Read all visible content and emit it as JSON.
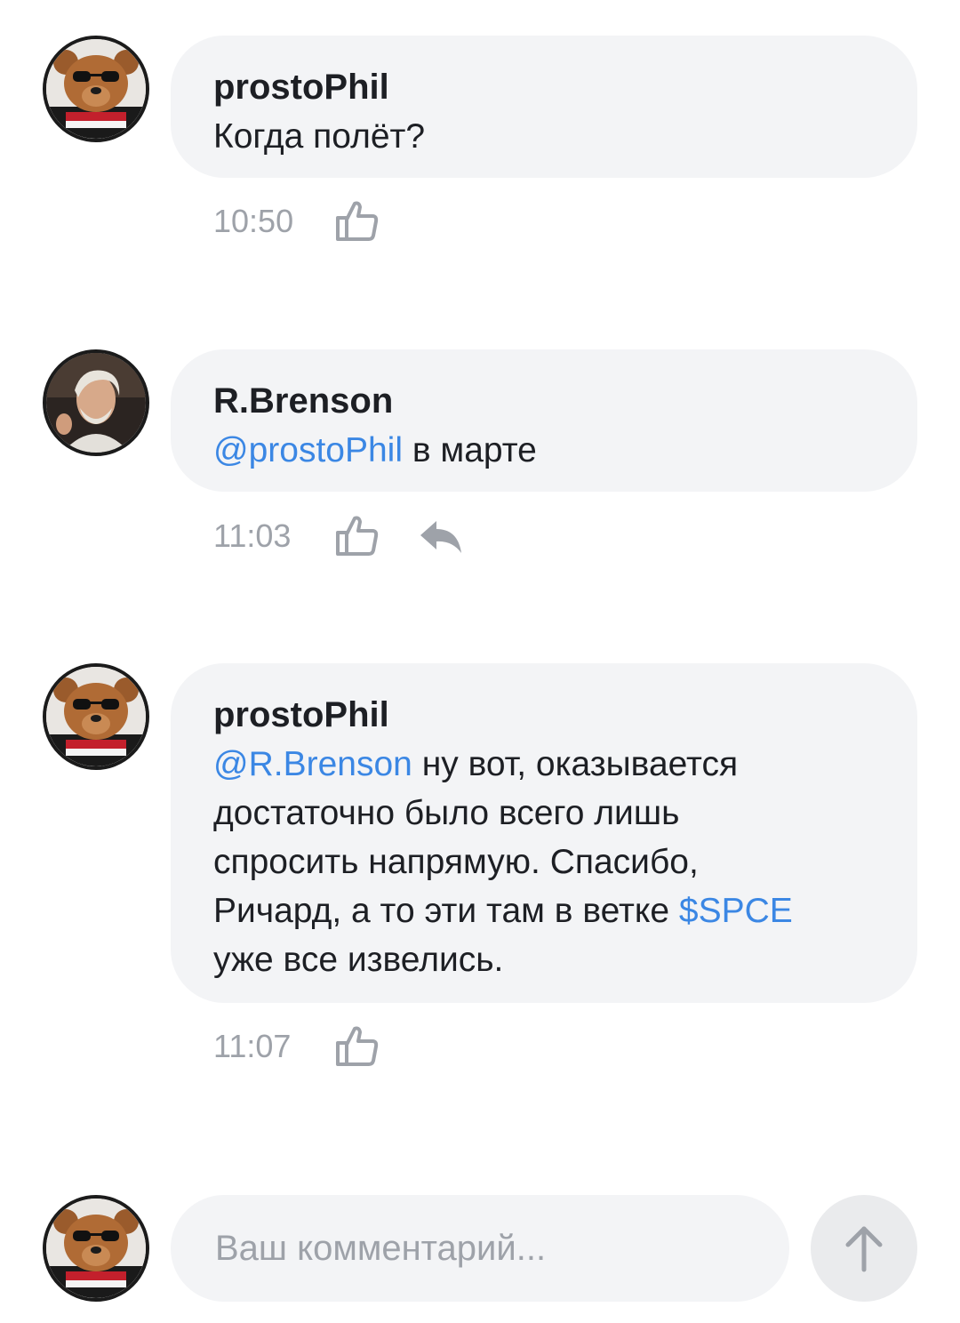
{
  "comments": [
    {
      "author": "prostoPhil",
      "avatar_icon": "bear-avatar-icon",
      "mention": "",
      "text": "Когда полёт?",
      "text_after": "",
      "time": "10:50",
      "has_reply": false
    },
    {
      "author": "R.Brenson",
      "avatar_icon": "person-avatar-icon",
      "mention": "@prostoPhil",
      "text": " в марте",
      "text_after": "",
      "time": "11:03",
      "has_reply": true
    },
    {
      "author": "prostoPhil",
      "avatar_icon": "bear-avatar-icon",
      "mention": "@R.Brenson",
      "text": " ну вот, оказывается\nдостаточно было всего лишь\nспросить напрямую. Спасибо,\nРичард, а то эти там в ветке ",
      "ticker": "$SPCE",
      "text_after": "\nуже все извелись.",
      "time": "11:07",
      "has_reply": false
    }
  ],
  "composer": {
    "placeholder": "Ваш комментарий...",
    "send_icon": "arrow-up-icon"
  },
  "colors": {
    "bubble": "#f3f4f6",
    "mention": "#3b87e4",
    "muted": "#9ea2a9",
    "text": "#1d1f24"
  }
}
